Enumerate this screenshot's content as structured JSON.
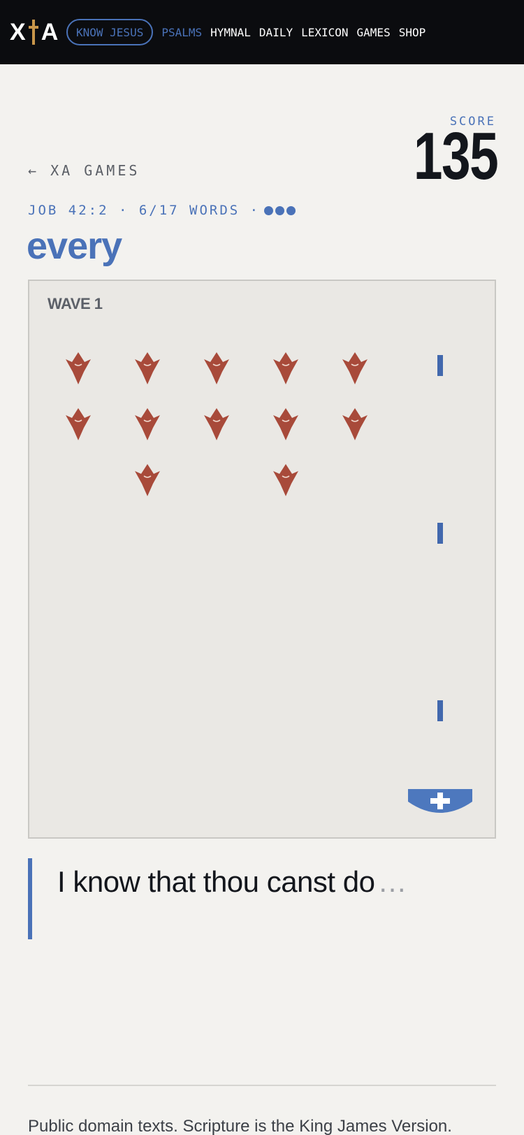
{
  "header": {
    "logo_left": "X",
    "logo_right": "A",
    "cta_label": "KNOW JESUS",
    "nav": [
      "PSALMS",
      "HYMNAL",
      "DAILY",
      "LEXICON",
      "GAMES",
      "SHOP"
    ],
    "active_nav": "PSALMS",
    "accent_color": "#4a72b8",
    "cross_color": "#c8964a"
  },
  "score": {
    "label": "SCORE",
    "value": "135"
  },
  "back_link": "← XA GAMES",
  "verse_meta": {
    "text": "JOB 42:2 · 6/17 WORDS ·",
    "lives": 3
  },
  "target_word": "every",
  "game": {
    "wave_label": "WAVE 1",
    "enemy_color": "#a84a3a",
    "bullet_color": "#4268ad",
    "player_icon": "cross-ship-icon",
    "enemy_icon": "arrowhead-invader-icon"
  },
  "verse": {
    "typed": "I know that thou canst do",
    "ellipsis": "…"
  },
  "footer": {
    "text": "Public domain texts. Scripture is the King James Version."
  }
}
